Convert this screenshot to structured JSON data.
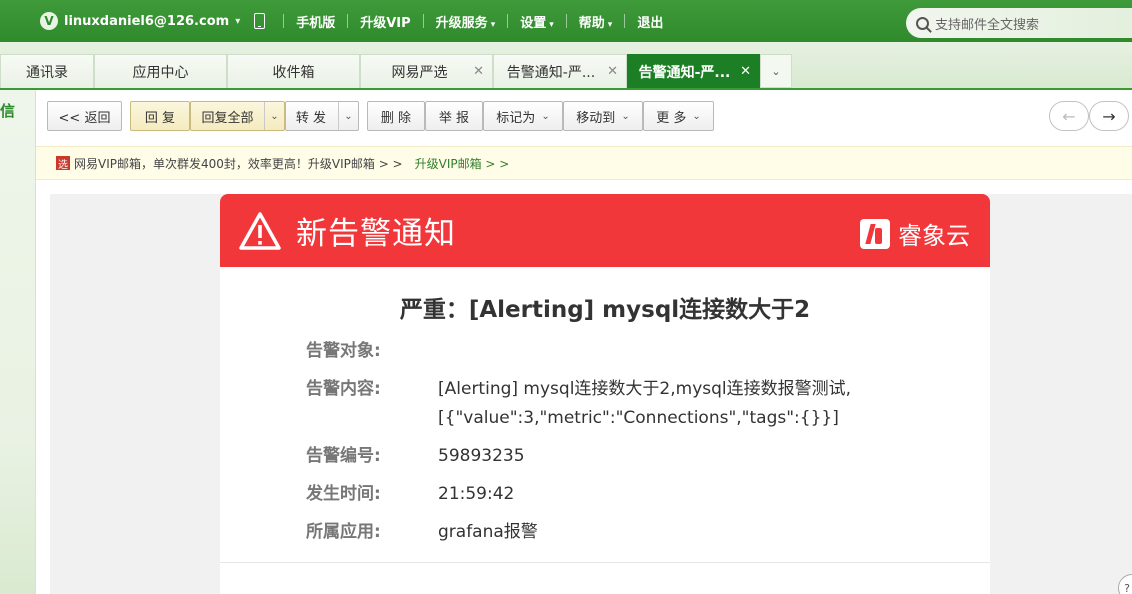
{
  "topbar": {
    "badge": "V",
    "email": "linuxdaniel6@126.com",
    "links": [
      {
        "label": "手机版"
      },
      {
        "label": "升级VIP"
      },
      {
        "label": "升级服务"
      },
      {
        "label": "设置"
      },
      {
        "label": "帮助"
      },
      {
        "label": "退出"
      }
    ],
    "search_placeholder": "支持邮件全文搜索"
  },
  "tabs": [
    {
      "label": "通讯录"
    },
    {
      "label": "应用中心"
    },
    {
      "label": "收件箱"
    },
    {
      "label": "网易严选"
    },
    {
      "label": "告警通知-严..."
    },
    {
      "label": "告警通知-严..."
    }
  ],
  "sidebar": {
    "label": "信"
  },
  "toolbar": {
    "back": "<< 返回",
    "reply": "回 复",
    "reply_all": "回复全部",
    "forward": "转 发",
    "delete": "删 除",
    "report": "举 报",
    "mark_as": "标记为",
    "move_to": "移动到",
    "more": "更 多",
    "prev_arrow": "←",
    "next_arrow": "→"
  },
  "vip_notice": {
    "icon": "选",
    "text": "网易VIP邮箱，单次群发400封，效率更高！升级VIP邮箱 > >",
    "link": "升级VIP邮箱 > >"
  },
  "mail": {
    "header_title": "新告警通知",
    "brand": "睿象云",
    "heading": "严重：[Alerting] mysql连接数大于2",
    "fields": [
      {
        "key": "告警对象:",
        "value": ""
      },
      {
        "key": "告警内容:",
        "value": "[Alerting] mysql连接数大于2,mysql连接数报警测试,[{\"value\":3,\"metric\":\"Connections\",\"tags\":{}}]"
      },
      {
        "key": "告警编号:",
        "value": "59893235"
      },
      {
        "key": "发生时间:",
        "value": "21:59:42"
      },
      {
        "key": "所属应用:",
        "value": "grafana报警"
      }
    ]
  },
  "colors": {
    "brand_green": "#2f8a2c",
    "active_tab": "#1d7f25",
    "alert_red": "#f2373a"
  }
}
